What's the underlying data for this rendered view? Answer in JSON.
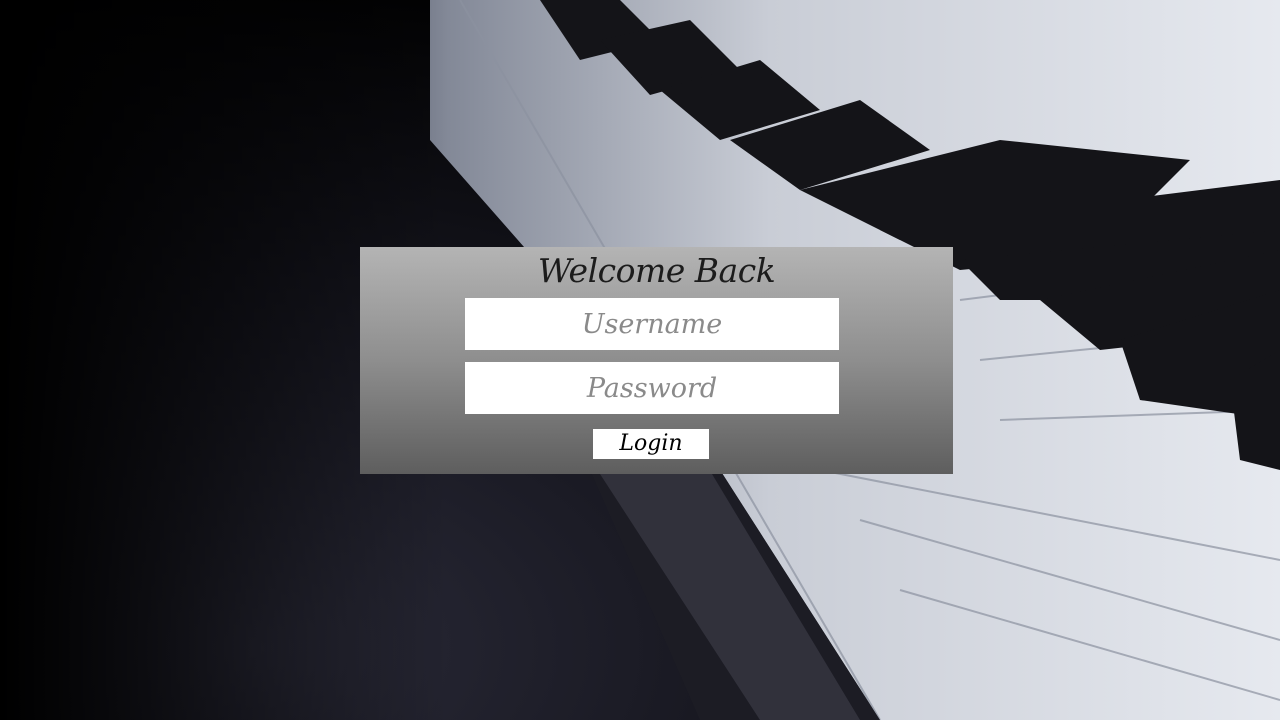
{
  "background": {
    "name": "piano-keys-photo"
  },
  "login": {
    "title": "Welcome Back",
    "username_placeholder": "Username",
    "username_value": "",
    "password_placeholder": "Password",
    "password_value": "",
    "button_label": "Login"
  },
  "colors": {
    "panel_top": "#b4b4b4",
    "panel_bottom": "#5e5e5e",
    "field_background": "#ffffff",
    "placeholder_text": "#8a8a8a",
    "title_text": "#1c1c1c"
  }
}
